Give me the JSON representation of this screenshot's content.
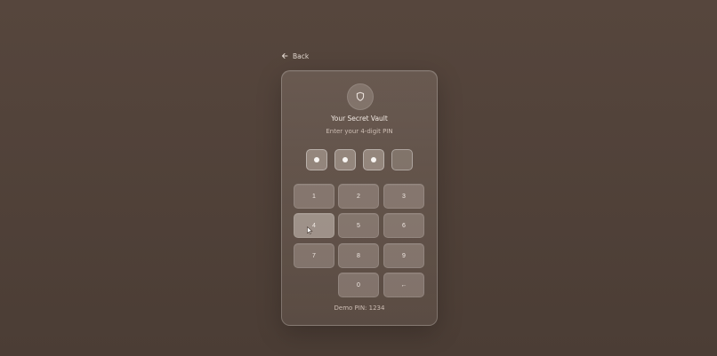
{
  "navigation": {
    "back_label": "Back",
    "back_icon": "arrow-left-icon"
  },
  "vault": {
    "shield_icon": "shield-icon",
    "title": "Your Secret Vault",
    "subtitle": "Enter your 4-digit PIN",
    "pin_length": 4,
    "entered_digits": 3,
    "keys": {
      "k1": "1",
      "k2": "2",
      "k3": "3",
      "k4": "4",
      "k5": "5",
      "k6": "6",
      "k7": "7",
      "k8": "8",
      "k9": "9",
      "k0": "0",
      "backspace": "←"
    },
    "demo_pin_text": "Demo PIN: 1234"
  },
  "colors": {
    "background": "#4f4038",
    "card_border": "#7b6d63",
    "text_light": "#f1e9e3",
    "text_muted": "#cdbdb3"
  }
}
